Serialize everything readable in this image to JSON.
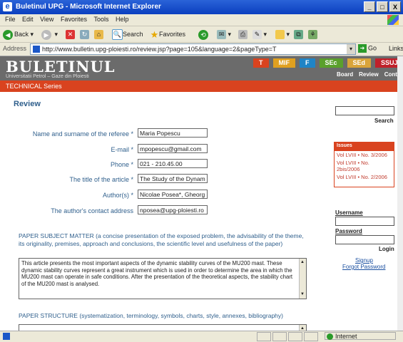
{
  "window": {
    "title": "Buletinul UPG - Microsoft Internet Explorer",
    "buttons": [
      "_",
      "□",
      "X"
    ]
  },
  "menu": [
    "File",
    "Edit",
    "View",
    "Favorites",
    "Tools",
    "Help"
  ],
  "toolbar": {
    "back": "Back",
    "search": "Search",
    "favorites": "Favorites"
  },
  "address": {
    "label": "Address",
    "url": "http://www.bulletin.upg-ploiesti.ro/review.jsp?page=105&language=2&pageType=T",
    "go": "Go",
    "links": "Links"
  },
  "site": {
    "logo": "BULETINUL",
    "sublogo": "Universitatii Petrol – Gaze din Ploiesti",
    "tabs": [
      {
        "label": "T",
        "color": "#d9431f"
      },
      {
        "label": "MIF",
        "color": "#e0a020"
      },
      {
        "label": "F",
        "color": "#1f84c6"
      },
      {
        "label": "SEc",
        "color": "#5aa02c"
      },
      {
        "label": "SEd",
        "color": "#d9a43a"
      },
      {
        "label": "SSUJ",
        "color": "#c0202a"
      }
    ],
    "nav": [
      "Board",
      "Review",
      "Contact"
    ],
    "series": "TECHNICAL Series"
  },
  "review": {
    "heading": "Review",
    "fields": [
      {
        "label": "Name and surname of the referee *",
        "value": "Maria Popescu"
      },
      {
        "label": "E-mail *",
        "value": "mpopescu@gmail.com"
      },
      {
        "label": "Phone *",
        "value": "021 - 210.45.00"
      },
      {
        "label": "The title of the article *",
        "value": "The Study of the Dynam"
      },
      {
        "label": "Author(s) *",
        "value": "Nicolae Posea*, Gheorg"
      },
      {
        "label": "The author's contact address",
        "value": "nposea@upg-ploiesti.ro"
      }
    ],
    "q1": "PAPER SUBJECT MATTER (a concise presentation of the exposed problem, the advisability of the theme, its originality, premises, approach and conclusions, the scientific level and usefulness of the paper)",
    "a1": "This article presents the most important aspects of the dynamic stability curves of the MU200 mast. These dynamic stability curves represent a great instrument which is used in order to determine the area in which the MU200 mast can operate in safe conditions. After the presentation of the theoretical aspects, the stability chart of the MU200 mast is analysed.",
    "q2": "PAPER STRUCTURE (systematization, terminology, symbols, charts, style, annexes, bibliography)"
  },
  "sidebar": {
    "search_label": "Search",
    "issues_title": "Issues",
    "issues": [
      "Vol LVIII • No. 3/2006",
      "Vol LVIII • No. 2bis/2006",
      "Vol LVIII • No. 2/2006"
    ],
    "username": "Username",
    "password": "Password",
    "login": "Login",
    "signup": "Signup",
    "forgot": "Forgot Password"
  },
  "status": {
    "zone": "Internet"
  }
}
